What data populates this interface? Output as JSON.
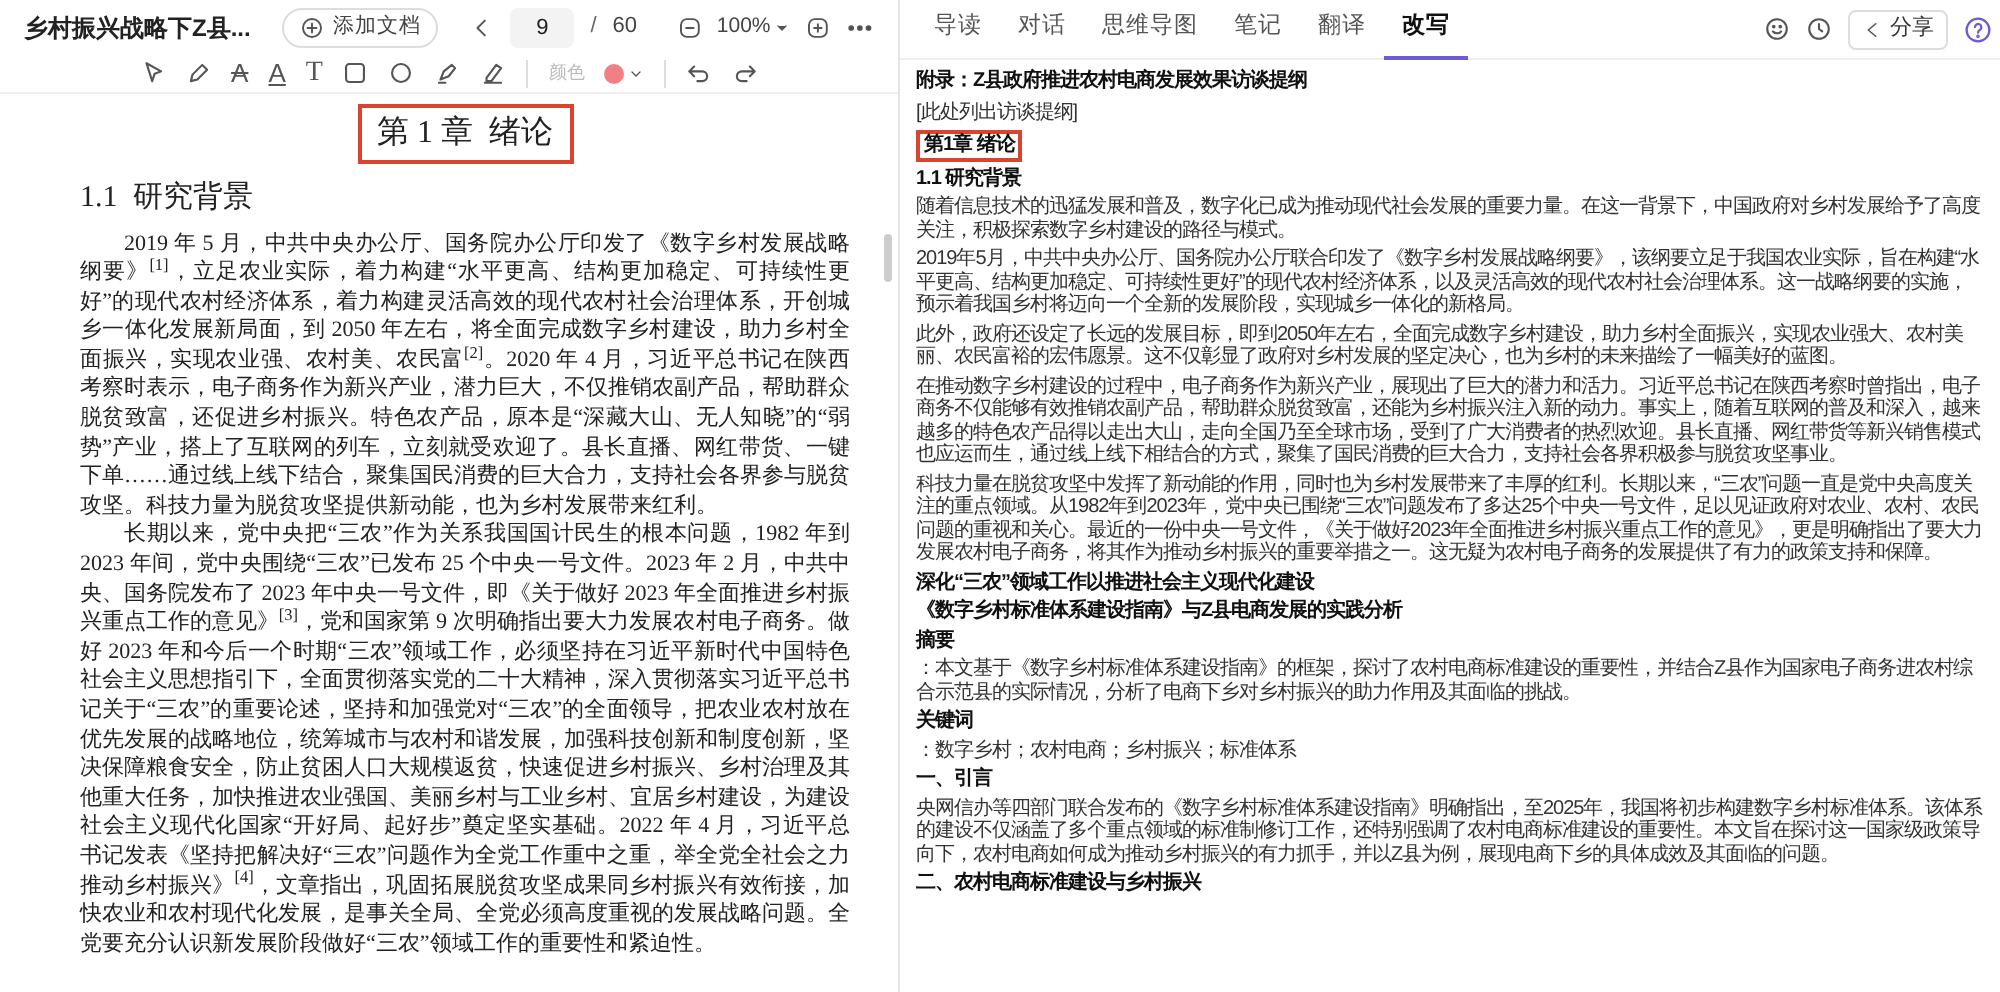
{
  "document_tab": {
    "title": "乡村振兴战略下Z县..."
  },
  "add_document": {
    "label": "添加文档"
  },
  "pager": {
    "page": "9",
    "separator": "/",
    "total": "60"
  },
  "zoom": {
    "value": "100%"
  },
  "annotation_toolbar": {
    "tools": [
      {
        "kind": "pointer"
      },
      {
        "kind": "pen"
      },
      {
        "kind": "strikethrough",
        "glyph": "A"
      },
      {
        "kind": "underline",
        "glyph": "A"
      },
      {
        "kind": "text",
        "glyph": "T"
      },
      {
        "kind": "rectangle"
      },
      {
        "kind": "ellipse"
      },
      {
        "kind": "marker"
      },
      {
        "kind": "highlighter"
      }
    ],
    "color_label": "颜色",
    "color": "#f07f86",
    "color_disabled": true
  },
  "tabs": [
    {
      "label": "导读",
      "selected": false
    },
    {
      "label": "对话",
      "selected": false
    },
    {
      "label": "思维导图",
      "selected": false
    },
    {
      "label": "笔记",
      "selected": false
    },
    {
      "label": "翻译",
      "selected": false
    },
    {
      "label": "改写",
      "selected": true
    }
  ],
  "share_button": {
    "label": "分享"
  },
  "left_page": {
    "chapter_title": "第 1 章  绪论",
    "chapter_boxed": true,
    "section_heading": "1.1  研究背景",
    "paragraphs": [
      "2019 年 5 月，中共中央办公厅、国务院办公厅印发了《数字乡村发展战略纲要》$^{[1]}$，立足农业实际，着力构建“水平更高、结构更加稳定、可持续性更好”的现代农村经济体系，着力构建灵活高效的现代农村社会治理体系，开创城乡一体化发展新局面，到 2050 年左右，将全面完成数字乡村建设，助力乡村全面振兴，实现农业强、农村美、农民富$^{[2]}$。2020 年 4 月，习近平总书记在陕西考察时表示，电子商务作为新兴产业，潜力巨大，不仅推销农副产品，帮助群众脱贫致富，还促进乡村振兴。特色农产品，原本是“深藏大山、无人知晓”的“弱势”产业，搭上了互联网的列车，立刻就受欢迎了。县长直播、网红带货、一键下单……通过线上线下结合，聚集国民消费的巨大合力，支持社会各界参与脱贫攻坚。科技力量为脱贫攻坚提供新动能，也为乡村发展带来红利。",
      "长期以来，党中央把“三农”作为关系我国国计民生的根本问题，1982 年到 2023 年间，党中央围绕“三农”已发布 25 个中央一号文件。2023 年 2 月，中共中央、国务院发布了 2023 年中央一号文件，即《关于做好 2023 年全面推进乡村振兴重点工作的意见》$^{[3]}$，党和国家第 9 次明确指出要大力发展农村电子商务。做好 2023 年和今后一个时期“三农”领域工作，必须坚持在习近平新时代中国特色社会主义思想指引下，全面贯彻落实党的二十大精神，深入贯彻落实习近平总书记关于“三农”的重要论述，坚持和加强党对“三农”的全面领导，把农业农村放在优先发展的战略地位，统筹城市与农村和谐发展，加强科技创新和制度创新，坚决保障粮食安全，防止贫困人口大规模返贫，快速促进乡村振兴、乡村治理及其他重大任务，加快推进农业强国、美丽乡村与工业乡村、宜居乡村建设，为建设社会主义现代化国家“开好局、起好步”奠定坚实基础。2022 年 4 月，习近平总书记发表《坚持把解决好“三农”问题作为全党工作重中之重，举全党全社会之力推动乡村振兴》$^{[4]}$，文章指出，巩固拓展脱贫攻坚成果同乡村振兴有效衔接，加快农业和农村现代化发展，是事关全局、全党必须高度重视的发展战略问题。全党要充分认识新发展阶段做好“三农”领域工作的重要性和紧迫性。"
    ]
  },
  "rewrite_panel": {
    "blocks": [
      {
        "kind": "title",
        "text": "附录：Z县政府推进农村电商发展效果访谈提纲"
      },
      {
        "kind": "paragraph",
        "text": "[此处列出访谈提纲]"
      },
      {
        "kind": "chapter",
        "text": "第1章 绪论",
        "boxed": true
      },
      {
        "kind": "heading",
        "text": "1.1 研究背景"
      },
      {
        "kind": "paragraph",
        "text": "随着信息技术的迅猛发展和普及，数字化已成为推动现代社会发展的重要力量。在这一背景下，中国政府对乡村发展给予了高度关注，积极探索数字乡村建设的路径与模式。"
      },
      {
        "kind": "paragraph",
        "text": "2019年5月，中共中央办公厅、国务院办公厅联合印发了《数字乡村发展战略纲要》，该纲要立足于我国农业实际，旨在构建“水平更高、结构更加稳定、可持续性更好”的现代农村经济体系，以及灵活高效的现代农村社会治理体系。这一战略纲要的实施，预示着我国乡村将迈向一个全新的发展阶段，实现城乡一体化的新格局。"
      },
      {
        "kind": "paragraph",
        "text": "此外，政府还设定了长远的发展目标，即到2050年左右，全面完成数字乡村建设，助力乡村全面振兴，实现农业强大、农村美丽、农民富裕的宏伟愿景。这不仅彰显了政府对乡村发展的坚定决心，也为乡村的未来描绘了一幅美好的蓝图。"
      },
      {
        "kind": "paragraph",
        "text": "在推动数字乡村建设的过程中，电子商务作为新兴产业，展现出了巨大的潜力和活力。习近平总书记在陕西考察时曾指出，电子商务不仅能够有效推销农副产品，帮助群众脱贫致富，还能为乡村振兴注入新的动力。事实上，随着互联网的普及和深入，越来越多的特色农产品得以走出大山，走向全国乃至全球市场，受到了广大消费者的热烈欢迎。县长直播、网红带货等新兴销售模式也应运而生，通过线上线下相结合的方式，聚集了国民消费的巨大合力，支持社会各界积极参与脱贫攻坚事业。"
      },
      {
        "kind": "paragraph",
        "text": "科技力量在脱贫攻坚中发挥了新动能的作用，同时也为乡村发展带来了丰厚的红利。长期以来，“三农”问题一直是党中央高度关注的重点领域。从1982年到2023年，党中央已围绕“三农”问题发布了多达25个中央一号文件，足以见证政府对农业、农村、农民问题的重视和关心。最近的一份中央一号文件，《关于做好2023年全面推进乡村振兴重点工作的意见》，更是明确指出了要大力发展农村电子商务，将其作为推动乡村振兴的重要举措之一。这无疑为农村电子商务的发展提供了有力的政策支持和保障。"
      },
      {
        "kind": "heading",
        "text": "深化“三农”领域工作以推进社会主义现代化建设"
      },
      {
        "kind": "heading",
        "text": "《数字乡村标准体系建设指南》与Z县电商发展的实践分析"
      },
      {
        "kind": "heading",
        "text": "摘要"
      },
      {
        "kind": "paragraph",
        "text": "：本文基于《数字乡村标准体系建设指南》的框架，探讨了农村电商标准建设的重要性，并结合Z县作为国家电子商务进农村综合示范县的实际情况，分析了电商下乡对乡村振兴的助力作用及其面临的挑战。"
      },
      {
        "kind": "heading",
        "text": "关键词"
      },
      {
        "kind": "paragraph",
        "text": "：数字乡村；农村电商；乡村振兴；标准体系"
      },
      {
        "kind": "heading",
        "text": "一、引言"
      },
      {
        "kind": "paragraph",
        "text": "央网信办等四部门联合发布的《数字乡村标准体系建设指南》明确指出，至2025年，我国将初步构建数字乡村标准体系。该体系的建设不仅涵盖了多个重点领域的标准制修订工作，还特别强调了农村电商标准建设的重要性。本文旨在探讨这一国家级政策导向下，农村电商如何成为推动乡村振兴的有力抓手，并以Z县为例，展现电商下乡的具体成效及其面临的问题。"
      },
      {
        "kind": "heading",
        "text": "二、农村电商标准建设与乡村振兴"
      }
    ]
  }
}
